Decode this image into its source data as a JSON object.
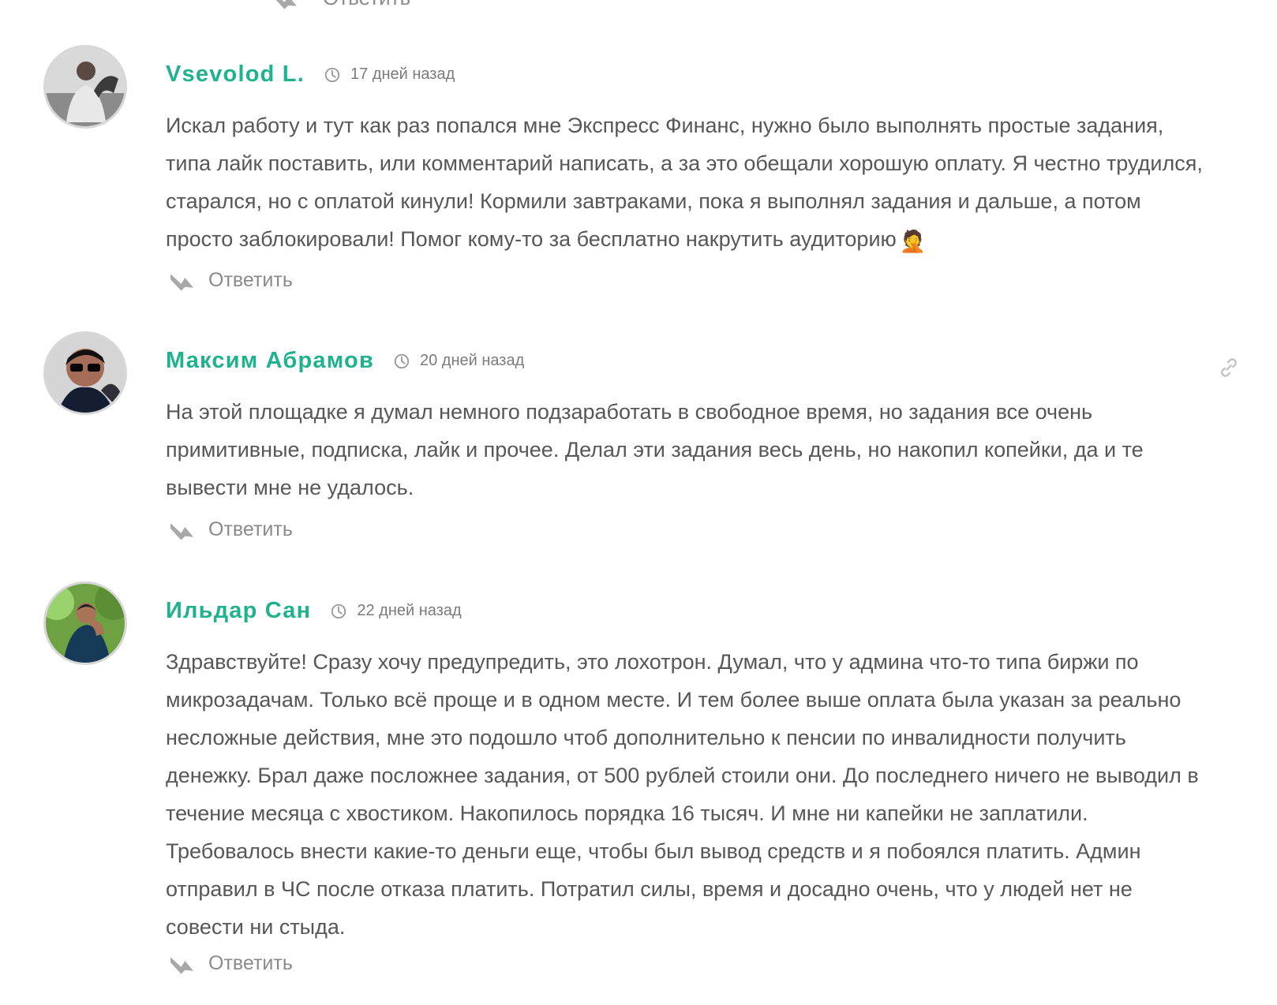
{
  "previous_reply": {
    "label": "Ответить",
    "icon": "reply-icon"
  },
  "comments": [
    {
      "author": "Vsevolod L.",
      "time": "17 дней назад",
      "text": "Искал работу и тут как раз попался мне Экспресс Финанс, нужно было выполнять простые задания, типа лайк поставить, или комментарий написать, а за это обещали хорошую оплату. Я честно трудился, старался, но с оплатой кинули! Кормили завтраками, пока я выполнял задания и дальше, а потом просто заблокировали! Помог кому-то за бесплатно накрутить аудиторию",
      "emoji": "🤦",
      "reply_label": "Ответить",
      "avatar_icon": "user-avatar-photo",
      "clock_icon": "clock-icon",
      "reply_icon": "reply-arrow-icon"
    },
    {
      "author": "Максим Абрамов",
      "time": "20 дней назад",
      "text": "На этой площадке я думал немного подзаработать в свободное время, но задания все очень примитивные, подписка, лайк и прочее. Делал эти задания весь день, но накопил копейки, да и те вывести мне не удалось.",
      "reply_label": "Ответить",
      "avatar_icon": "user-avatar-photo",
      "clock_icon": "clock-icon",
      "reply_icon": "reply-arrow-icon",
      "link_icon": "link-icon"
    },
    {
      "author": "Ильдар Сан",
      "time": "22 дней назад",
      "text": "Здравствуйте! Сразу хочу предупредить, это лохотрон. Думал, что у админа что-то типа биржи по микрозадачам. Только всё проще и в одном месте. И тем более выше оплата была указан за реально несложные действия, мне это подошло чтоб дополнительно к пенсии по инвалидности получить денежку. Брал даже посложнее задания, от 500 рублей стоили они. До последнего ничего не выводил в течение месяца с хвостиком. Накопилось порядка 16 тысяч. И мне ни капейки не заплатили. Требовалось внести какие-то деньги еще, чтобы был вывод средств и я побоялся платить. Админ отправил в ЧС после отказа платить. Потратил силы, время и досадно очень, что у людей нет не совести ни стыда.",
      "reply_label": "Ответить",
      "avatar_icon": "user-avatar-photo",
      "clock_icon": "clock-icon",
      "reply_icon": "reply-arrow-icon"
    }
  ],
  "colors": {
    "author": "#20b28f",
    "text": "#575757",
    "muted": "#8a8a8a",
    "avatar_border": "#d7d7d7"
  }
}
